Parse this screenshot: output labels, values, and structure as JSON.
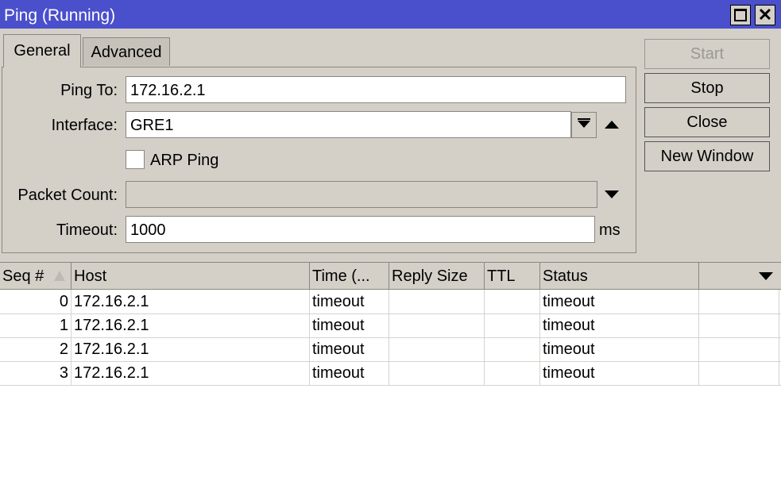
{
  "window": {
    "title": "Ping (Running)"
  },
  "tabs": [
    {
      "label": "General"
    },
    {
      "label": "Advanced"
    }
  ],
  "form": {
    "ping_to": {
      "label": "Ping To:",
      "value": "172.16.2.1"
    },
    "interface": {
      "label": "Interface:",
      "value": "GRE1"
    },
    "arp_ping": {
      "label": "ARP Ping",
      "checked": false
    },
    "packet_count": {
      "label": "Packet Count:",
      "value": ""
    },
    "timeout": {
      "label": "Timeout:",
      "value": "1000",
      "unit": "ms"
    }
  },
  "buttons": {
    "start": "Start",
    "stop": "Stop",
    "close": "Close",
    "new_window": "New Window"
  },
  "table": {
    "columns": [
      "Seq #",
      "Host",
      "Time (...",
      "Reply Size",
      "TTL",
      "Status"
    ],
    "rows": [
      {
        "seq": "0",
        "host": "172.16.2.1",
        "time": "timeout",
        "reply_size": "",
        "ttl": "",
        "status": "timeout"
      },
      {
        "seq": "1",
        "host": "172.16.2.1",
        "time": "timeout",
        "reply_size": "",
        "ttl": "",
        "status": "timeout"
      },
      {
        "seq": "2",
        "host": "172.16.2.1",
        "time": "timeout",
        "reply_size": "",
        "ttl": "",
        "status": "timeout"
      },
      {
        "seq": "3",
        "host": "172.16.2.1",
        "time": "timeout",
        "reply_size": "",
        "ttl": "",
        "status": "timeout"
      }
    ]
  },
  "colors": {
    "titlebar": "#4a4fcc",
    "window_bg": "#d4d0c8"
  }
}
